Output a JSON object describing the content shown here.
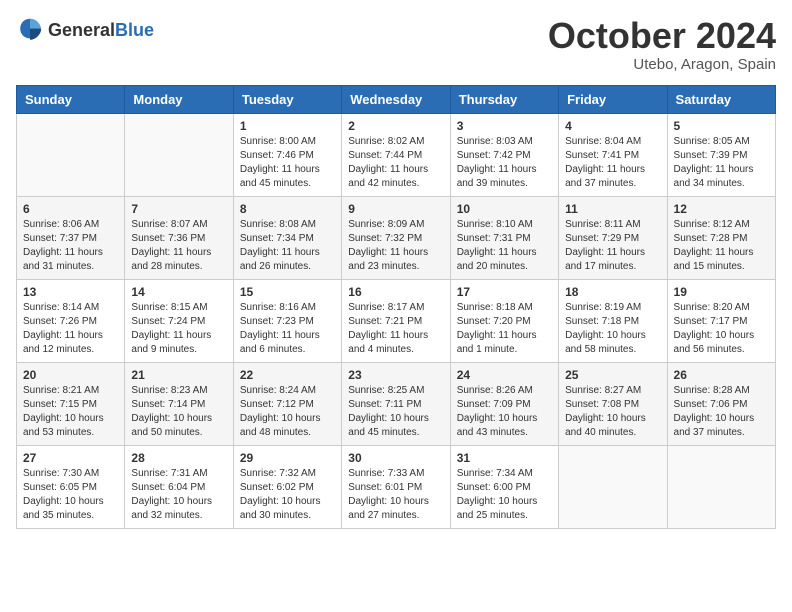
{
  "header": {
    "logo_general": "General",
    "logo_blue": "Blue",
    "month": "October 2024",
    "location": "Utebo, Aragon, Spain"
  },
  "weekdays": [
    "Sunday",
    "Monday",
    "Tuesday",
    "Wednesday",
    "Thursday",
    "Friday",
    "Saturday"
  ],
  "rows": [
    [
      {
        "day": "",
        "sunrise": "",
        "sunset": "",
        "daylight": ""
      },
      {
        "day": "",
        "sunrise": "",
        "sunset": "",
        "daylight": ""
      },
      {
        "day": "1",
        "sunrise": "Sunrise: 8:00 AM",
        "sunset": "Sunset: 7:46 PM",
        "daylight": "Daylight: 11 hours and 45 minutes."
      },
      {
        "day": "2",
        "sunrise": "Sunrise: 8:02 AM",
        "sunset": "Sunset: 7:44 PM",
        "daylight": "Daylight: 11 hours and 42 minutes."
      },
      {
        "day": "3",
        "sunrise": "Sunrise: 8:03 AM",
        "sunset": "Sunset: 7:42 PM",
        "daylight": "Daylight: 11 hours and 39 minutes."
      },
      {
        "day": "4",
        "sunrise": "Sunrise: 8:04 AM",
        "sunset": "Sunset: 7:41 PM",
        "daylight": "Daylight: 11 hours and 37 minutes."
      },
      {
        "day": "5",
        "sunrise": "Sunrise: 8:05 AM",
        "sunset": "Sunset: 7:39 PM",
        "daylight": "Daylight: 11 hours and 34 minutes."
      }
    ],
    [
      {
        "day": "6",
        "sunrise": "Sunrise: 8:06 AM",
        "sunset": "Sunset: 7:37 PM",
        "daylight": "Daylight: 11 hours and 31 minutes."
      },
      {
        "day": "7",
        "sunrise": "Sunrise: 8:07 AM",
        "sunset": "Sunset: 7:36 PM",
        "daylight": "Daylight: 11 hours and 28 minutes."
      },
      {
        "day": "8",
        "sunrise": "Sunrise: 8:08 AM",
        "sunset": "Sunset: 7:34 PM",
        "daylight": "Daylight: 11 hours and 26 minutes."
      },
      {
        "day": "9",
        "sunrise": "Sunrise: 8:09 AM",
        "sunset": "Sunset: 7:32 PM",
        "daylight": "Daylight: 11 hours and 23 minutes."
      },
      {
        "day": "10",
        "sunrise": "Sunrise: 8:10 AM",
        "sunset": "Sunset: 7:31 PM",
        "daylight": "Daylight: 11 hours and 20 minutes."
      },
      {
        "day": "11",
        "sunrise": "Sunrise: 8:11 AM",
        "sunset": "Sunset: 7:29 PM",
        "daylight": "Daylight: 11 hours and 17 minutes."
      },
      {
        "day": "12",
        "sunrise": "Sunrise: 8:12 AM",
        "sunset": "Sunset: 7:28 PM",
        "daylight": "Daylight: 11 hours and 15 minutes."
      }
    ],
    [
      {
        "day": "13",
        "sunrise": "Sunrise: 8:14 AM",
        "sunset": "Sunset: 7:26 PM",
        "daylight": "Daylight: 11 hours and 12 minutes."
      },
      {
        "day": "14",
        "sunrise": "Sunrise: 8:15 AM",
        "sunset": "Sunset: 7:24 PM",
        "daylight": "Daylight: 11 hours and 9 minutes."
      },
      {
        "day": "15",
        "sunrise": "Sunrise: 8:16 AM",
        "sunset": "Sunset: 7:23 PM",
        "daylight": "Daylight: 11 hours and 6 minutes."
      },
      {
        "day": "16",
        "sunrise": "Sunrise: 8:17 AM",
        "sunset": "Sunset: 7:21 PM",
        "daylight": "Daylight: 11 hours and 4 minutes."
      },
      {
        "day": "17",
        "sunrise": "Sunrise: 8:18 AM",
        "sunset": "Sunset: 7:20 PM",
        "daylight": "Daylight: 11 hours and 1 minute."
      },
      {
        "day": "18",
        "sunrise": "Sunrise: 8:19 AM",
        "sunset": "Sunset: 7:18 PM",
        "daylight": "Daylight: 10 hours and 58 minutes."
      },
      {
        "day": "19",
        "sunrise": "Sunrise: 8:20 AM",
        "sunset": "Sunset: 7:17 PM",
        "daylight": "Daylight: 10 hours and 56 minutes."
      }
    ],
    [
      {
        "day": "20",
        "sunrise": "Sunrise: 8:21 AM",
        "sunset": "Sunset: 7:15 PM",
        "daylight": "Daylight: 10 hours and 53 minutes."
      },
      {
        "day": "21",
        "sunrise": "Sunrise: 8:23 AM",
        "sunset": "Sunset: 7:14 PM",
        "daylight": "Daylight: 10 hours and 50 minutes."
      },
      {
        "day": "22",
        "sunrise": "Sunrise: 8:24 AM",
        "sunset": "Sunset: 7:12 PM",
        "daylight": "Daylight: 10 hours and 48 minutes."
      },
      {
        "day": "23",
        "sunrise": "Sunrise: 8:25 AM",
        "sunset": "Sunset: 7:11 PM",
        "daylight": "Daylight: 10 hours and 45 minutes."
      },
      {
        "day": "24",
        "sunrise": "Sunrise: 8:26 AM",
        "sunset": "Sunset: 7:09 PM",
        "daylight": "Daylight: 10 hours and 43 minutes."
      },
      {
        "day": "25",
        "sunrise": "Sunrise: 8:27 AM",
        "sunset": "Sunset: 7:08 PM",
        "daylight": "Daylight: 10 hours and 40 minutes."
      },
      {
        "day": "26",
        "sunrise": "Sunrise: 8:28 AM",
        "sunset": "Sunset: 7:06 PM",
        "daylight": "Daylight: 10 hours and 37 minutes."
      }
    ],
    [
      {
        "day": "27",
        "sunrise": "Sunrise: 7:30 AM",
        "sunset": "Sunset: 6:05 PM",
        "daylight": "Daylight: 10 hours and 35 minutes."
      },
      {
        "day": "28",
        "sunrise": "Sunrise: 7:31 AM",
        "sunset": "Sunset: 6:04 PM",
        "daylight": "Daylight: 10 hours and 32 minutes."
      },
      {
        "day": "29",
        "sunrise": "Sunrise: 7:32 AM",
        "sunset": "Sunset: 6:02 PM",
        "daylight": "Daylight: 10 hours and 30 minutes."
      },
      {
        "day": "30",
        "sunrise": "Sunrise: 7:33 AM",
        "sunset": "Sunset: 6:01 PM",
        "daylight": "Daylight: 10 hours and 27 minutes."
      },
      {
        "day": "31",
        "sunrise": "Sunrise: 7:34 AM",
        "sunset": "Sunset: 6:00 PM",
        "daylight": "Daylight: 10 hours and 25 minutes."
      },
      {
        "day": "",
        "sunrise": "",
        "sunset": "",
        "daylight": ""
      },
      {
        "day": "",
        "sunrise": "",
        "sunset": "",
        "daylight": ""
      }
    ]
  ]
}
